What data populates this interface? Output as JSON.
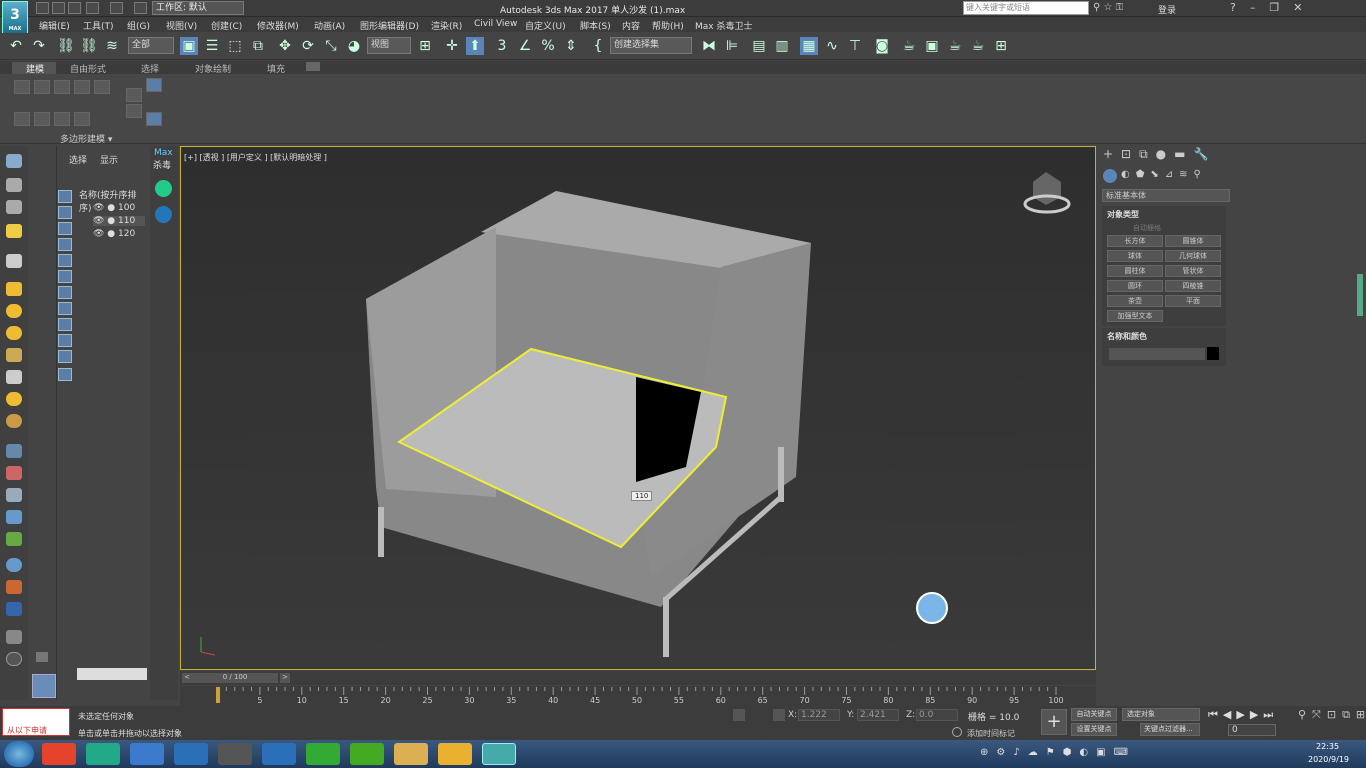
{
  "window": {
    "title": "Autodesk 3ds Max 2017    单人沙发 (1).max",
    "logo": "3",
    "logo_sub": "MAX",
    "workspace": "工作区: 默认",
    "search_placeholder": "键入关键字或短语",
    "login": "登录"
  },
  "menu": [
    "编辑(E)",
    "工具(T)",
    "组(G)",
    "视图(V)",
    "创建(C)",
    "修改器(M)",
    "动画(A)",
    "图形编辑器(D)",
    "渲染(R)",
    "Civil View",
    "自定义(U)",
    "脚本(S)",
    "内容",
    "帮助(H)",
    "Max 杀毒卫士"
  ],
  "toolbar": {
    "filter": "全部",
    "view": "视图",
    "selset": "创建选择集"
  },
  "ribbon": {
    "tabs": [
      "建模",
      "自由形式",
      "选择",
      "对象绘制",
      "填充"
    ],
    "panel_label": "多边形建模 ▾"
  },
  "scene_explorer": {
    "tabs": [
      "选择",
      "显示"
    ],
    "header": "名称(按升序排序)",
    "items": [
      "100",
      "110",
      "120"
    ]
  },
  "plugin": {
    "title": "Max",
    "subtitle": "杀毒"
  },
  "viewport": {
    "label": "[+] [透视 ] [用户定义 ] [默认明暗处理 ]",
    "tag": "110"
  },
  "command_panel": {
    "dropdown": "标准基本体",
    "rollout1": "对象类型",
    "autogrid": "自动栅格",
    "buttons": [
      "长方体",
      "圆锥体",
      "球体",
      "几何球体",
      "圆柱体",
      "管状体",
      "圆环",
      "四棱锥",
      "茶壶",
      "平面",
      "加强型文本"
    ],
    "rollout2": "名称和颜色"
  },
  "timeline": {
    "frame": "0 / 100",
    "ticks": [
      "0",
      "5",
      "10",
      "15",
      "20",
      "25",
      "30",
      "35",
      "40",
      "45",
      "50",
      "55",
      "60",
      "65",
      "70",
      "75",
      "80",
      "85",
      "90",
      "95",
      "100"
    ]
  },
  "status": {
    "line1": "未选定任何对象",
    "line2": "单击或单击并拖动以选择对象",
    "left_text": "从以下申请",
    "x_label": "X:",
    "x": "1.222",
    "y_label": "Y:",
    "y": "2.421",
    "z_label": "Z:",
    "z": "0.0",
    "grid": "栅格 = 10.0",
    "add_tag": "添加时间标记",
    "autokey": "自动关键点",
    "setkey": "设置关键点",
    "sel_object": "选定对象",
    "keyfilter": "关键点过滤器...",
    "frame_field": "0"
  },
  "taskbar": {
    "time": "22:35",
    "date": "2020/9/19"
  }
}
